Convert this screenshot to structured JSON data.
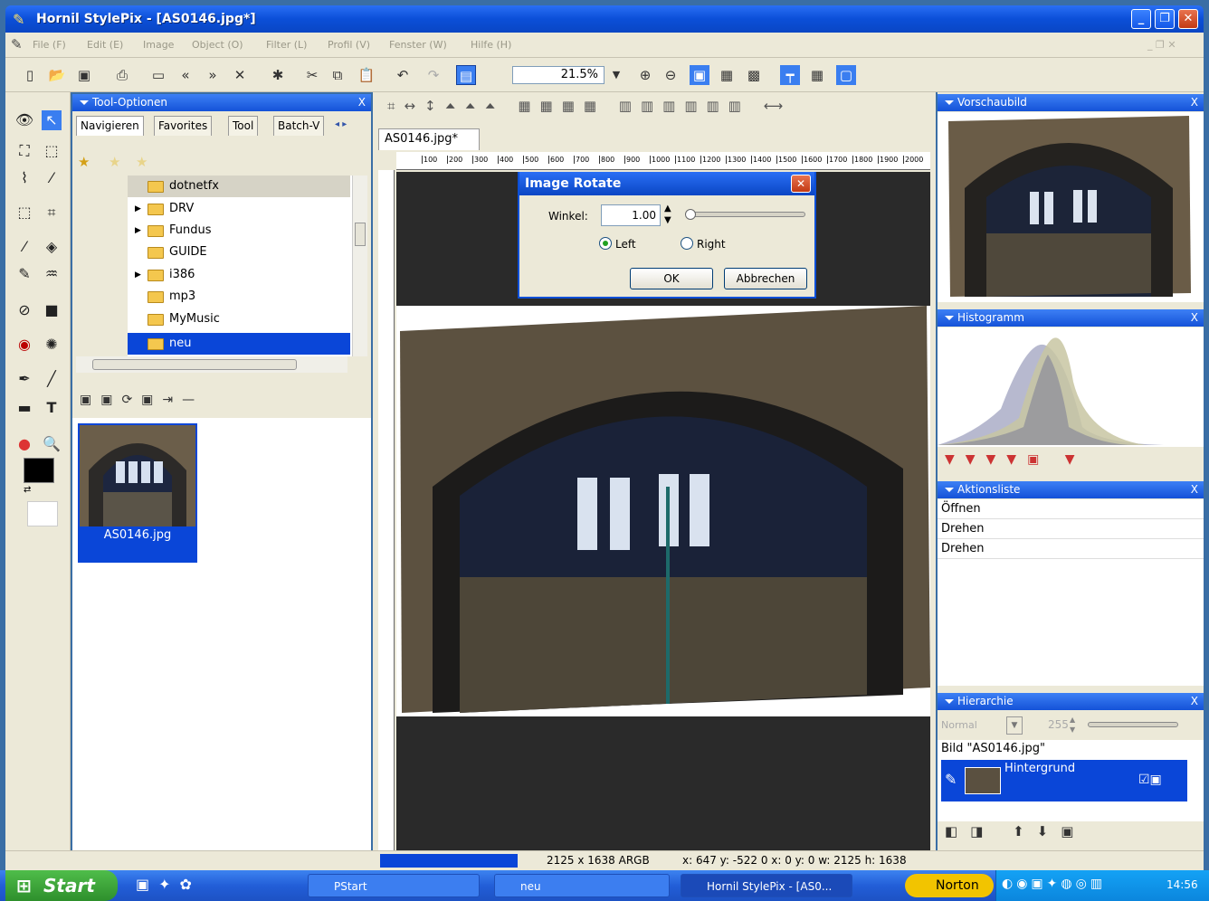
{
  "window": {
    "title": "Hornil StylePix - [AS0146.jpg*]"
  },
  "menu": [
    "File (F)",
    "Edit (E)",
    "Image",
    "Object (O)",
    "Filter (L)",
    "Profil (V)",
    "Fenster (W)",
    "Hilfe (H)"
  ],
  "toolbar": {
    "zoom": "21.5%"
  },
  "tool_options": {
    "title": "Tool-Optionen",
    "tabs": [
      "Navigieren",
      "Favorites",
      "Tool",
      "Batch-V"
    ],
    "folders": [
      "dotnetfx",
      "DRV",
      "Fundus",
      "GUIDE",
      "i386",
      "mp3",
      "MyMusic",
      "neu"
    ],
    "selected_folder": "neu",
    "thumbnail_label": "AS0146.jpg"
  },
  "document": {
    "tab": "AS0146.jpg*",
    "ruler_ticks": [
      "100",
      "200",
      "300",
      "400",
      "500",
      "600",
      "700",
      "800",
      "900",
      "1000",
      "1100",
      "1200",
      "1300",
      "1400",
      "1500",
      "1600",
      "1700",
      "1800",
      "1900",
      "2000"
    ]
  },
  "dialog": {
    "title": "Image Rotate",
    "angle_label": "Winkel:",
    "angle_value": "1.00",
    "left_label": "Left",
    "right_label": "Right",
    "ok_label": "OK",
    "cancel_label": "Abbrechen",
    "left_selected": true
  },
  "panels": {
    "preview_title": "Vorschaubild",
    "histogram_title": "Histogramm",
    "actions_title": "Aktionsliste",
    "actions": [
      "Öffnen",
      "Drehen",
      "Drehen"
    ],
    "hierarchy_title": "Hierarchie",
    "blend_label": "Normal",
    "opacity": "255",
    "image_label": "Bild \"AS0146.jpg\"",
    "layer_name": "Hintergrund"
  },
  "status": {
    "size": "2125 x 1638 ARGB",
    "coords": "x: 647 y: -522  0 x:  0 y:  0 w: 2125 h: 1638"
  },
  "taskbar": {
    "start": "Start",
    "tasks": [
      "PStart",
      "neu",
      "Hornil StylePix - [AS0..."
    ],
    "norton": "Norton",
    "clock": "14:56"
  },
  "colors": {
    "titlebar": "#0b4fd8",
    "face": "#ece9d8",
    "selection": "#0a46d8"
  }
}
